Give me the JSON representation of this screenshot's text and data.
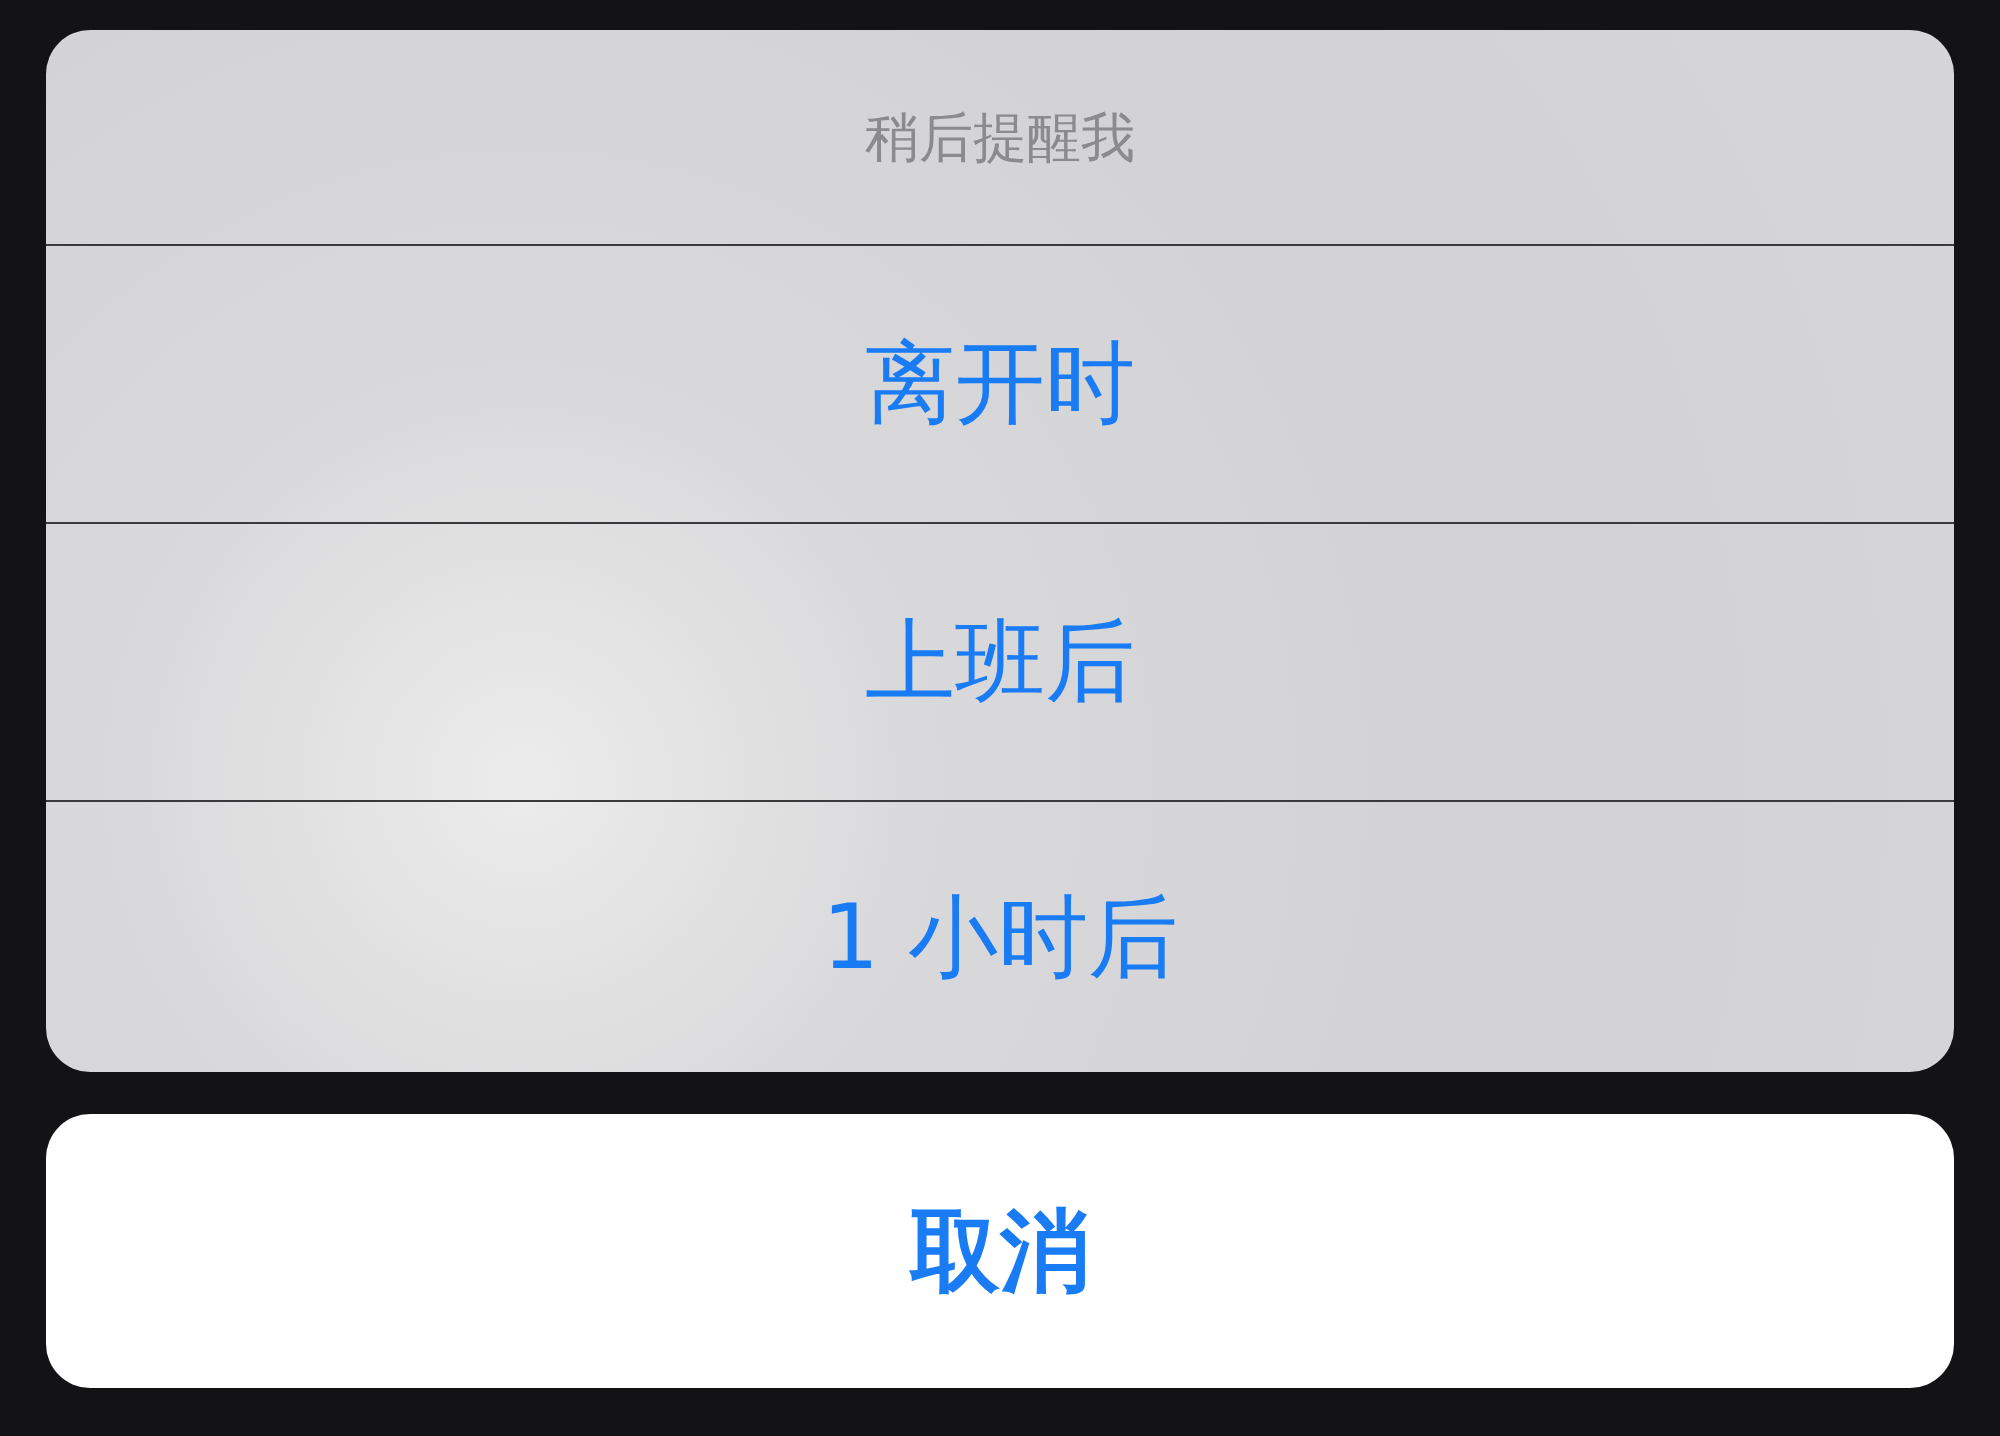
{
  "sheet": {
    "title": "稍后提醒我",
    "options": [
      "离开时",
      "上班后",
      "1 小时后"
    ]
  },
  "cancel_button": "取消"
}
